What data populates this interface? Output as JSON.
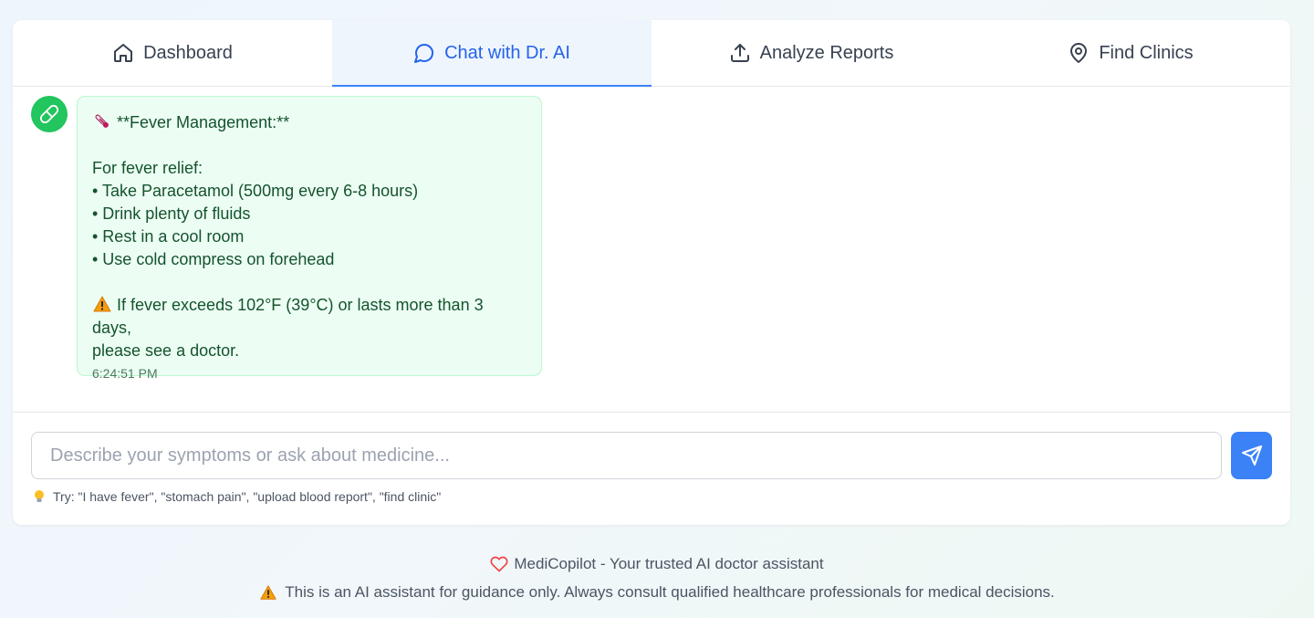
{
  "tabs": [
    {
      "label": "Dashboard",
      "icon": "home-icon",
      "active": false
    },
    {
      "label": "Chat with Dr. AI",
      "icon": "chat-bubble-icon",
      "active": true
    },
    {
      "label": "Analyze Reports",
      "icon": "upload-icon",
      "active": false
    },
    {
      "label": "Find Clinics",
      "icon": "map-pin-icon",
      "active": false
    }
  ],
  "message": {
    "avatar_icon": "pill-icon",
    "title": "**Fever Management:**",
    "title_emoji": "thermometer-icon",
    "intro": "For fever relief:",
    "bullets": [
      "• Take Paracetamol (500mg every 6-8 hours)",
      "• Drink plenty of fluids",
      "• Rest in a cool room",
      "• Use cold compress on forehead"
    ],
    "warning_line1": "If fever exceeds 102°F (39°C) or lasts more than 3 days,",
    "warning_line2": "please see a doctor.",
    "time": "6:24:51 PM"
  },
  "input": {
    "placeholder": "Describe your symptoms or ask about medicine...",
    "value": ""
  },
  "send_button_icon": "send-icon",
  "hint": "Try: \"I have fever\", \"stomach pain\", \"upload blood report\", \"find clinic\"",
  "footer": {
    "brand_line": "MediCopilot - Your trusted AI doctor assistant",
    "disclaimer": "This is an AI assistant for guidance only. Always consult qualified healthcare professionals for medical decisions."
  },
  "colors": {
    "accent": "#3b82f6",
    "bot_avatar": "#22c55e",
    "bubble_bg": "#ecfdf3",
    "bubble_text": "#14532d"
  }
}
